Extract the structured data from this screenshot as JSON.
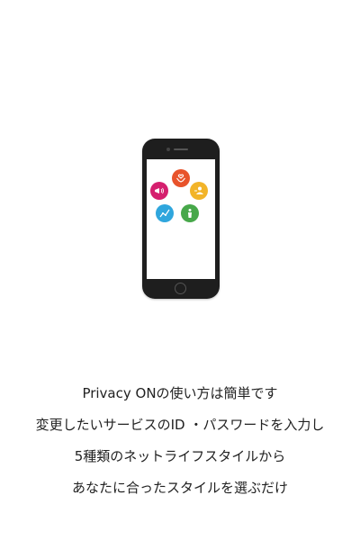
{
  "illustration": {
    "icons": [
      {
        "name": "hands-heart-icon",
        "color": "#e8532b"
      },
      {
        "name": "person-icon",
        "color": "#f2b429"
      },
      {
        "name": "megaphone-icon",
        "color": "#d51f6e"
      },
      {
        "name": "chart-icon",
        "color": "#2fa6dd"
      },
      {
        "name": "figure-icon",
        "color": "#47a84a"
      }
    ],
    "phone_color": "#1e1e1e"
  },
  "caption": {
    "line1": "Privacy ONの使い方は簡単です",
    "line2": "変更したいサービスのID ・パスワードを入力し",
    "line3": "5種類のネットライフスタイルから",
    "line4": "あなたに合ったスタイルを選ぶだけ"
  }
}
